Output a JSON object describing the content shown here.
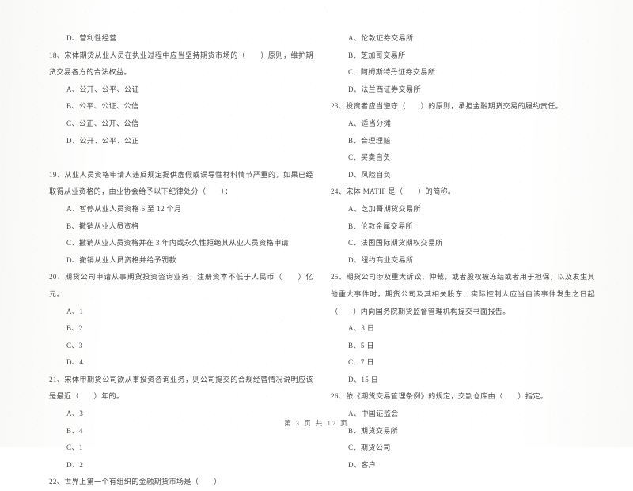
{
  "document": {
    "kind": "scanned-exam-page",
    "language": "zh-CN",
    "footer_text": "第 3 页 共 17 页",
    "page_number": "3",
    "total_pages": "17"
  },
  "left_column": {
    "blocks": [
      {
        "type": "option",
        "text": "D、营利性经营"
      },
      {
        "type": "stem",
        "text": "18、宋体期货从业人员在执业过程中应当坚持期货市场的（　　）原则，维护期货交易各方的合法权益。"
      },
      {
        "type": "option",
        "text": "A、公开、公平、公证"
      },
      {
        "type": "option",
        "text": "B、公平、公证、公信"
      },
      {
        "type": "option",
        "text": "C、公正、公开、公信"
      },
      {
        "type": "option",
        "text": "D、公开、公平、公正"
      },
      {
        "type": "blank",
        "text": ""
      },
      {
        "type": "stem",
        "text": "19、从业人员资格申请人违反规定提供虚假或误导性材料情节严重的，如果已经取得从业资格的，由业协会给予以下纪律处分（　　）："
      },
      {
        "type": "option",
        "text": "A、暂停从业人员资格 6 至 12 个月"
      },
      {
        "type": "option",
        "text": "B、撤销从业人员资格"
      },
      {
        "type": "option",
        "text": "C、撤销从业人员资格并在 3 年内或永久性拒绝其从业人员资格申请"
      },
      {
        "type": "option",
        "text": "D、撤销从业人员资格并给予罚款"
      },
      {
        "type": "stem",
        "text": "20、期货公司申请从事期货投资咨询业务，注册资本不低于人民币（　　）亿元。"
      },
      {
        "type": "option",
        "text": "A、1"
      },
      {
        "type": "option",
        "text": "B、2"
      },
      {
        "type": "option",
        "text": "C、3"
      },
      {
        "type": "option",
        "text": "D、4"
      },
      {
        "type": "stem",
        "text": "21、宋体甲期货公司欲从事投资咨询业务，则公司提交的合规经营情况说明应该是最近（　　）年的。"
      },
      {
        "type": "option",
        "text": "A、3"
      },
      {
        "type": "option",
        "text": "B、4"
      },
      {
        "type": "option",
        "text": "C、1"
      },
      {
        "type": "option",
        "text": "D、2"
      },
      {
        "type": "stem",
        "text": "22、世界上第一个有组织的金融期货市场是（　　）"
      }
    ]
  },
  "right_column": {
    "blocks": [
      {
        "type": "option",
        "text": "A、伦敦证券交易所"
      },
      {
        "type": "option",
        "text": "B、芝加哥交易所"
      },
      {
        "type": "option",
        "text": "C、阿姆斯特丹证券交易所"
      },
      {
        "type": "option",
        "text": "D、法兰西证券交易所"
      },
      {
        "type": "stem",
        "text": "23、投资者应当遵守（　　）的原则，承担金融期货交易的履约责任。"
      },
      {
        "type": "option",
        "text": "A、适当分摊"
      },
      {
        "type": "option",
        "text": "B、合理理赔"
      },
      {
        "type": "option",
        "text": "C、买卖自负"
      },
      {
        "type": "option",
        "text": "D、风险自负"
      },
      {
        "type": "stem",
        "text": "24、宋体 MATIF 是（　　）的简称。"
      },
      {
        "type": "option",
        "text": "A、芝加哥期货交易所"
      },
      {
        "type": "option",
        "text": "B、伦敦金属交易所"
      },
      {
        "type": "option",
        "text": "C、法国国际期货期权交易所"
      },
      {
        "type": "option",
        "text": "D、纽约商业交易所"
      },
      {
        "type": "stem",
        "text": "25、期货公司涉及重大诉讼、仲裁，或者股权被冻结或者用于担保，以及发生其他重大事件时，期货公司及其相关股东、实际控制人应当自该事件发生之日起（　　）内向国务院期货监督管理机构提交书面报告。"
      },
      {
        "type": "option",
        "text": "A、3 日"
      },
      {
        "type": "option",
        "text": "B、5 日"
      },
      {
        "type": "option",
        "text": "C、7 日"
      },
      {
        "type": "option",
        "text": "D、15 日"
      },
      {
        "type": "stem",
        "text": "26、依《期货交易管理条例》的规定，交割仓库由（　　）指定。"
      },
      {
        "type": "option",
        "text": "A、中国证监会"
      },
      {
        "type": "option",
        "text": "B、期货交易所"
      },
      {
        "type": "option",
        "text": "C、期货公司"
      },
      {
        "type": "option",
        "text": "D、客户"
      }
    ]
  }
}
